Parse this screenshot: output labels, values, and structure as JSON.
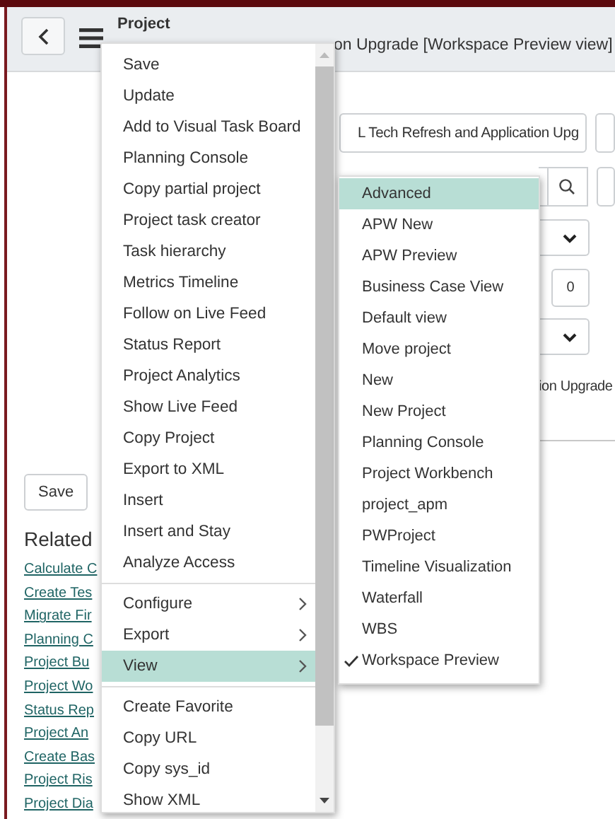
{
  "header": {
    "title": "Project",
    "subtitle": "on Upgrade [Workspace Preview view]"
  },
  "form": {
    "name_value": "L Tech Refresh and Application Upg",
    "number_value": "0",
    "description_fragment": "ion Upgrade"
  },
  "save_button": "Save",
  "related": {
    "heading": "Related",
    "links": [
      "Calculate C",
      "Create Tes",
      "Migrate Fir",
      "Planning C",
      "Project Bu",
      "Project Wo",
      "Status Rep",
      "Project An",
      "Create Bas",
      "Project Ris",
      "Project Dia"
    ]
  },
  "context_menu": {
    "items": [
      {
        "kind": "item",
        "label": "Save",
        "highlighted": false
      },
      {
        "kind": "item",
        "label": "Update",
        "highlighted": false
      },
      {
        "kind": "item",
        "label": "Add to Visual Task Board",
        "highlighted": false
      },
      {
        "kind": "item",
        "label": "Planning Console",
        "highlighted": false
      },
      {
        "kind": "item",
        "label": "Copy partial project",
        "highlighted": false
      },
      {
        "kind": "item",
        "label": "Project task creator",
        "highlighted": false
      },
      {
        "kind": "item",
        "label": "Task hierarchy",
        "highlighted": false
      },
      {
        "kind": "item",
        "label": "Metrics Timeline",
        "highlighted": false
      },
      {
        "kind": "item",
        "label": "Follow on Live Feed",
        "highlighted": false
      },
      {
        "kind": "item",
        "label": "Status Report",
        "highlighted": false
      },
      {
        "kind": "item",
        "label": "Project Analytics",
        "highlighted": false
      },
      {
        "kind": "item",
        "label": "Show Live Feed",
        "highlighted": false
      },
      {
        "kind": "item",
        "label": "Copy Project",
        "highlighted": false
      },
      {
        "kind": "item",
        "label": "Export to XML",
        "highlighted": false
      },
      {
        "kind": "item",
        "label": "Insert",
        "highlighted": false
      },
      {
        "kind": "item",
        "label": "Insert and Stay",
        "highlighted": false
      },
      {
        "kind": "item",
        "label": "Analyze Access",
        "highlighted": false
      },
      {
        "kind": "divider"
      },
      {
        "kind": "submenu",
        "label": "Configure",
        "highlighted": false
      },
      {
        "kind": "submenu",
        "label": "Export",
        "highlighted": false
      },
      {
        "kind": "submenu",
        "label": "View",
        "highlighted": true
      },
      {
        "kind": "divider"
      },
      {
        "kind": "item",
        "label": "Create Favorite",
        "highlighted": false
      },
      {
        "kind": "item",
        "label": "Copy URL",
        "highlighted": false
      },
      {
        "kind": "item",
        "label": "Copy sys_id",
        "highlighted": false
      },
      {
        "kind": "item",
        "label": "Show XML",
        "highlighted": false
      }
    ]
  },
  "view_submenu": {
    "items": [
      {
        "label": "Advanced",
        "highlighted": true,
        "checked": false
      },
      {
        "label": "APW New",
        "highlighted": false,
        "checked": false
      },
      {
        "label": "APW Preview",
        "highlighted": false,
        "checked": false
      },
      {
        "label": "Business Case View",
        "highlighted": false,
        "checked": false
      },
      {
        "label": "Default view",
        "highlighted": false,
        "checked": false
      },
      {
        "label": "Move project",
        "highlighted": false,
        "checked": false
      },
      {
        "label": "New",
        "highlighted": false,
        "checked": false
      },
      {
        "label": "New Project",
        "highlighted": false,
        "checked": false
      },
      {
        "label": "Planning Console",
        "highlighted": false,
        "checked": false
      },
      {
        "label": "Project Workbench",
        "highlighted": false,
        "checked": false
      },
      {
        "label": "project_apm",
        "highlighted": false,
        "checked": false
      },
      {
        "label": "PWProject",
        "highlighted": false,
        "checked": false
      },
      {
        "label": "Timeline Visualization",
        "highlighted": false,
        "checked": false
      },
      {
        "label": "Waterfall",
        "highlighted": false,
        "checked": false
      },
      {
        "label": "WBS",
        "highlighted": false,
        "checked": false
      },
      {
        "label": "Workspace Preview",
        "highlighted": false,
        "checked": true
      }
    ]
  }
}
